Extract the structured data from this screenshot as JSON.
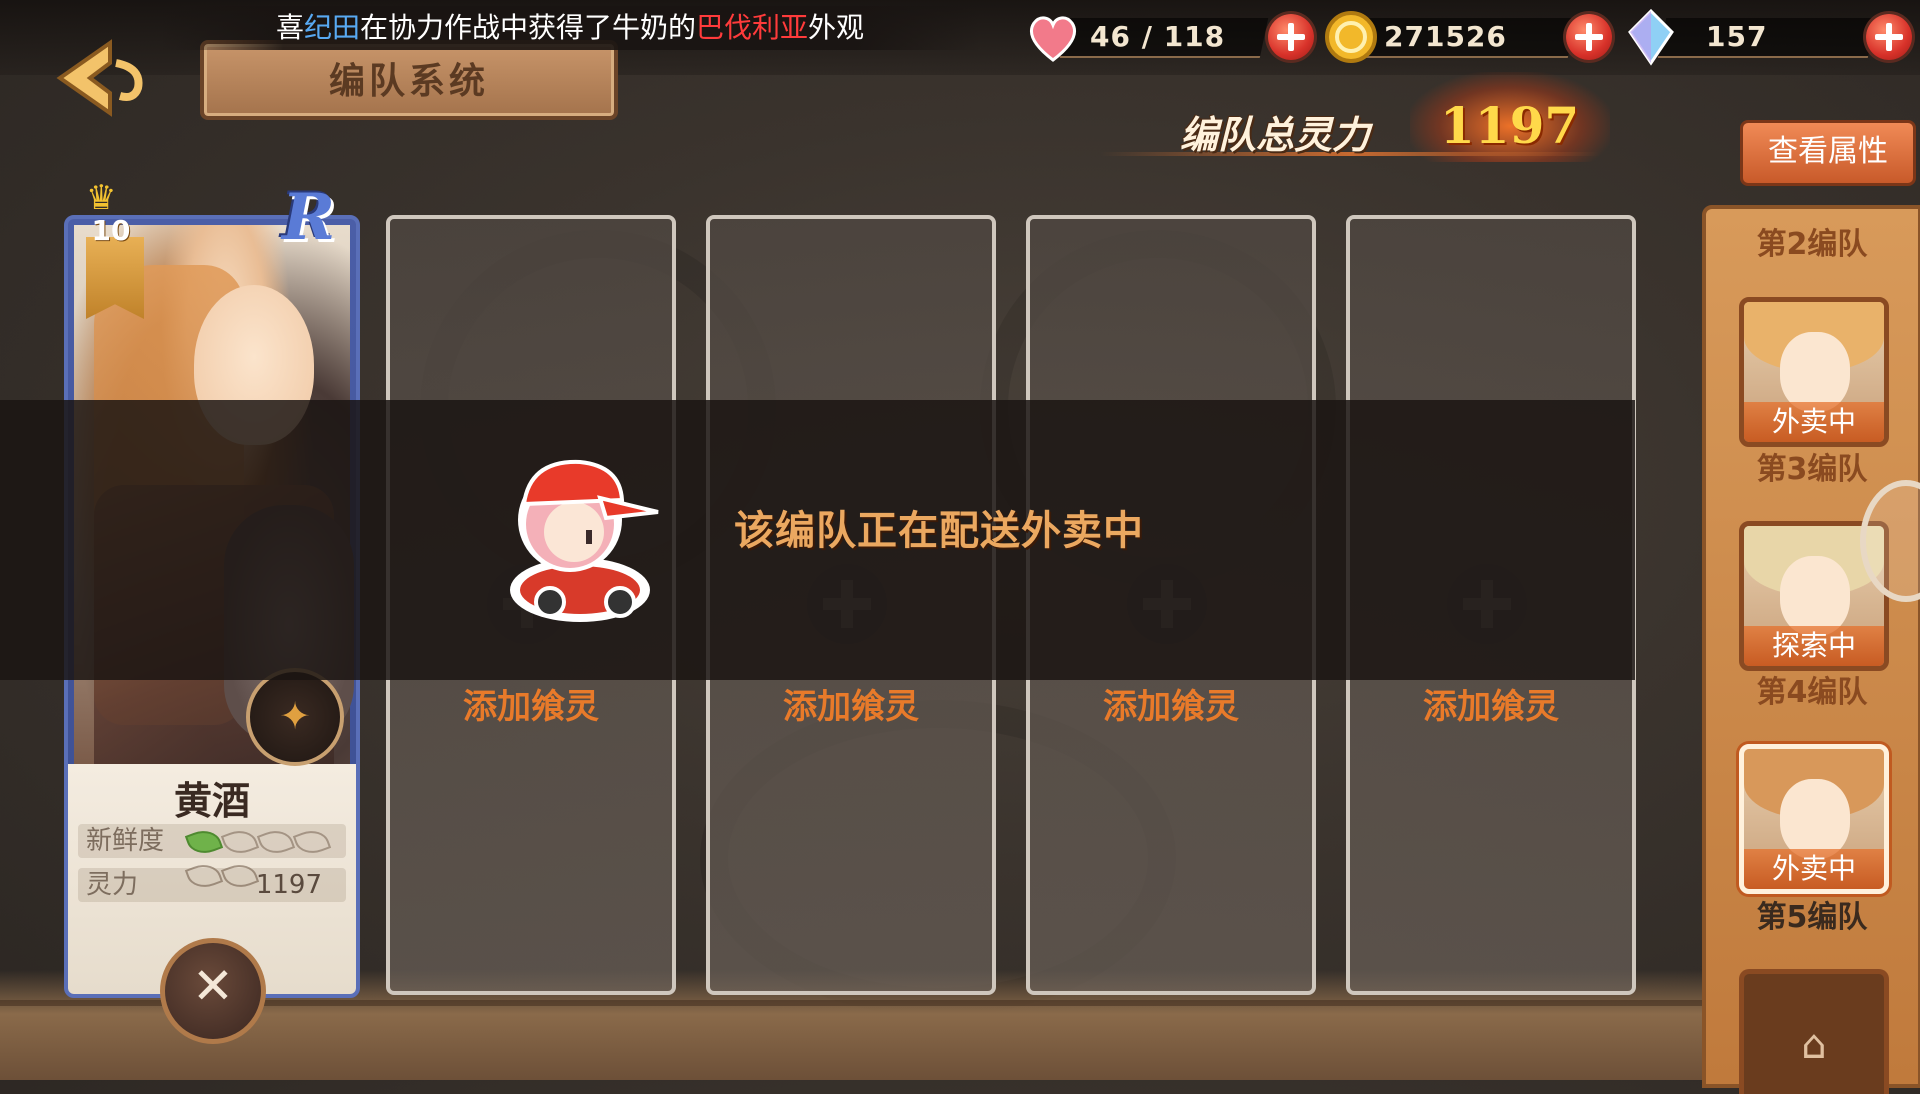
{
  "announcement": {
    "prefix": "喜",
    "player": "纪田",
    "middle": "在协力作战中获得了牛奶的",
    "item": "巴伐利亚",
    "suffix": "外观"
  },
  "title": "编队系统",
  "resources": {
    "stamina": "46 / 118",
    "gold": "271526",
    "crystal": "157"
  },
  "team_power": {
    "label": "编队总灵力",
    "value": "1197"
  },
  "attributes_button": "查看属性",
  "character": {
    "level": "10",
    "rarity": "R",
    "name": "黄酒",
    "freshness_label": "新鲜度",
    "freshness_level": 1,
    "freshness_max": 6,
    "power_label": "灵力",
    "power_value": "1197"
  },
  "slots": [
    {
      "label": "添加飨灵"
    },
    {
      "label": "添加飨灵"
    },
    {
      "label": "添加飨灵"
    },
    {
      "label": "添加飨灵"
    }
  ],
  "overlay_message": "该编队正在配送外卖中",
  "teams": [
    {
      "label": "第2编队"
    },
    {
      "label": "第3编队",
      "status": "外卖中"
    },
    {
      "label": "第4编队",
      "status": "探索中"
    },
    {
      "label": "第5编队",
      "status": "外卖中"
    }
  ],
  "colors": {
    "accent_orange": "#e87a2a",
    "power_gold": "#ffd94a",
    "panel_orange": "#d89a5a"
  }
}
